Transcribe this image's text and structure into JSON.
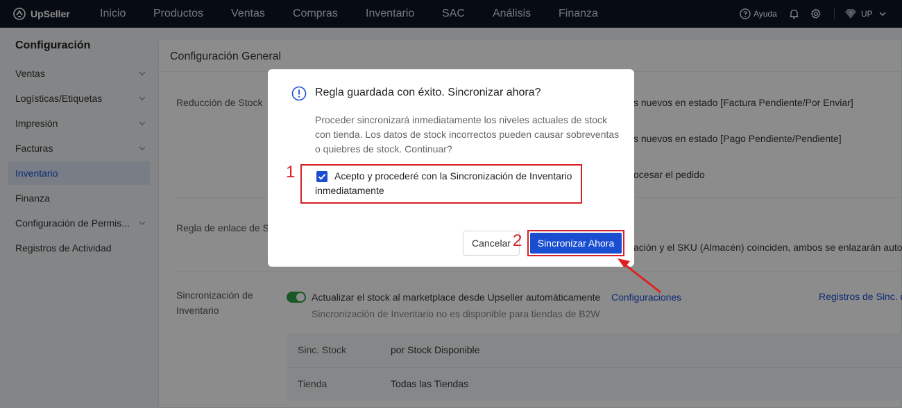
{
  "brand": {
    "name": "UpSeller"
  },
  "nav": {
    "items": [
      "Inicio",
      "Productos",
      "Ventas",
      "Compras",
      "Inventario",
      "SAC",
      "Análisis",
      "Finanza"
    ]
  },
  "topright": {
    "help": "Ayuda",
    "user": "UP"
  },
  "sidebar": {
    "title": "Configuración",
    "items": [
      {
        "label": "Ventas",
        "expandable": true
      },
      {
        "label": "Logísticas/Etiquetas",
        "expandable": true
      },
      {
        "label": "Impresión",
        "expandable": true
      },
      {
        "label": "Facturas",
        "expandable": true
      },
      {
        "label": "Inventario",
        "expandable": false,
        "active": true
      },
      {
        "label": "Finanza",
        "expandable": false
      },
      {
        "label": "Configuración de Permis...",
        "expandable": true
      },
      {
        "label": "Registros de Actividad",
        "expandable": false
      }
    ]
  },
  "main": {
    "title": "Configuración General",
    "stock_reduction": {
      "label": "Reducción de Stock",
      "option1": "s nuevos en estado [Factura Pendiente/Por Enviar]",
      "option2": "s nuevos en estado [Pago Pendiente/Pendiente]",
      "option3": "ocesar el pedido"
    },
    "link_rule": {
      "label": "Regla de enlace de S",
      "text": "ación y el SKU (Almacén) coinciden, ambos se enlazarán auto"
    },
    "inventory_sync": {
      "label": "Sincronización de Inventario",
      "toggle_on": true,
      "toggle_text": "Actualizar el stock al marketplace desde Upseller automáticamente",
      "config_link": "Configuraciones",
      "logs_link": "Registros de Sinc. d",
      "note": "Sincronización de Inventario no es disponible para tiendas de B2W",
      "rows": [
        {
          "key": "Sinc. Stock",
          "value": "por Stock Disponible"
        },
        {
          "key": "Tienda",
          "value": "Todas las Tiendas"
        }
      ]
    }
  },
  "modal": {
    "title": "Regla guardada con éxito. Sincronizar ahora?",
    "body": "Proceder sincronizará inmediatamente los niveles actuales de stock con tienda. Los datos de stock incorrectos pueden causar sobreventas o quiebres de stock. Continuar?",
    "checkbox_checked": true,
    "checkbox_label": "Acepto y procederé con la Sincronización de Inventario inmediatamente",
    "cancel": "Cancelar",
    "confirm": "Sincronizar Ahora"
  },
  "annotations": {
    "step1": "1",
    "step2": "2"
  },
  "colors": {
    "primary": "#1a4ed1",
    "topbar": "#0e1726",
    "highlight": "#d61f26",
    "toggle": "#2f9e44"
  }
}
